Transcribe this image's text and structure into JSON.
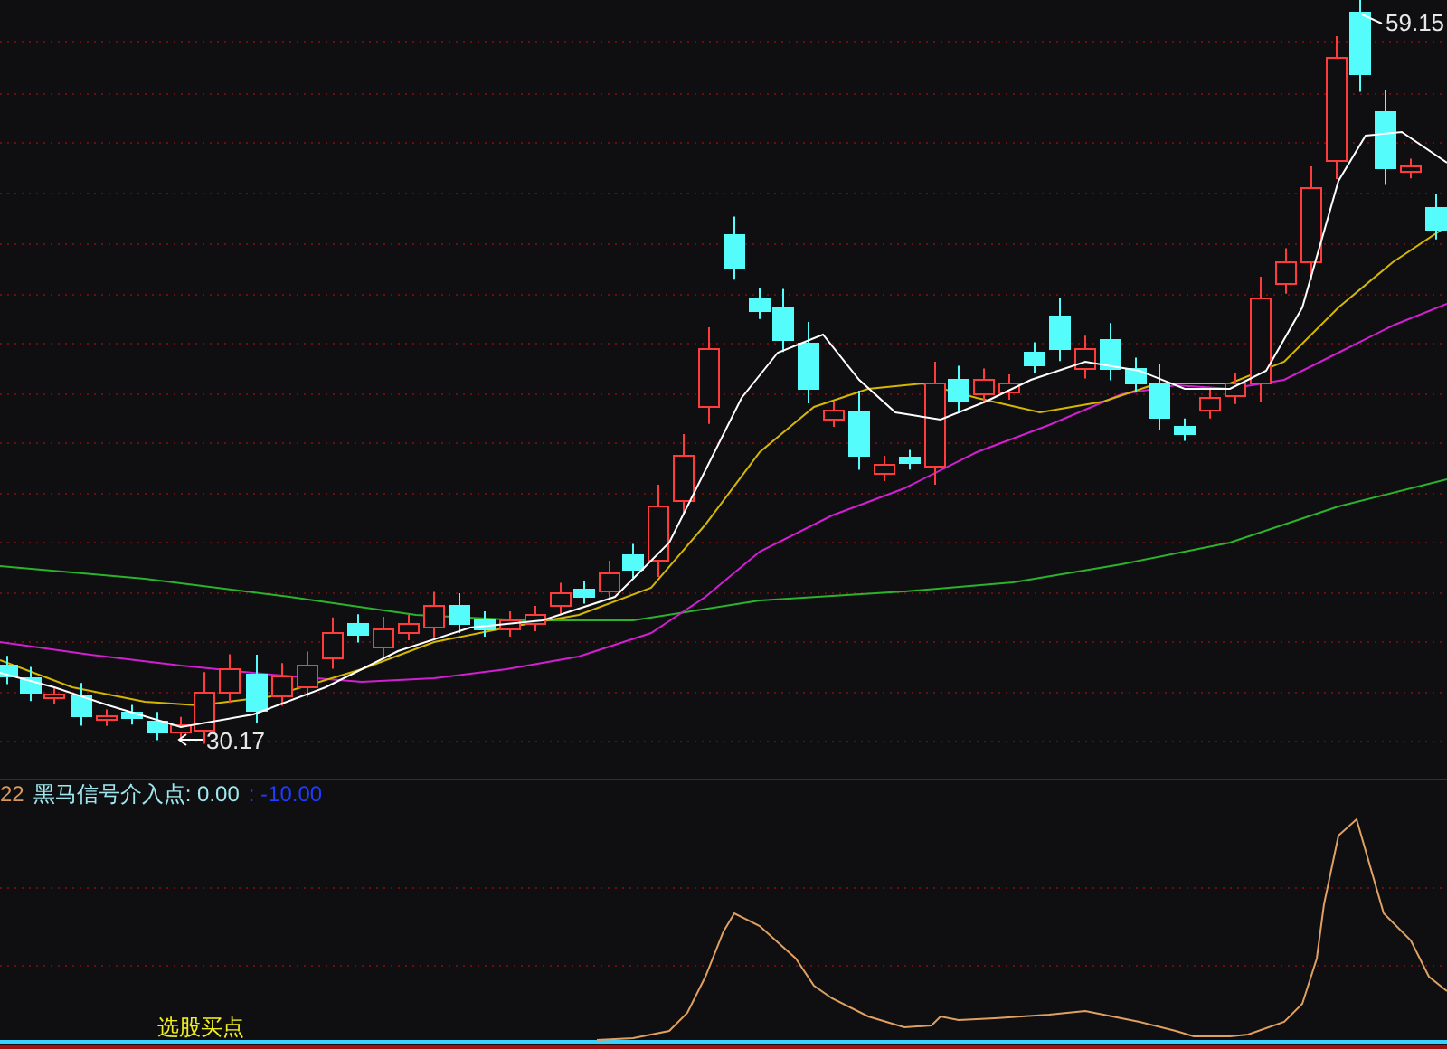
{
  "price_chart": {
    "high_label": "59.15",
    "low_label": "30.17"
  },
  "indicator": {
    "period": "22",
    "name": "黑马信号介入点: 0.00",
    "value": ": -10.00",
    "signal_label": "选股买点"
  }
}
